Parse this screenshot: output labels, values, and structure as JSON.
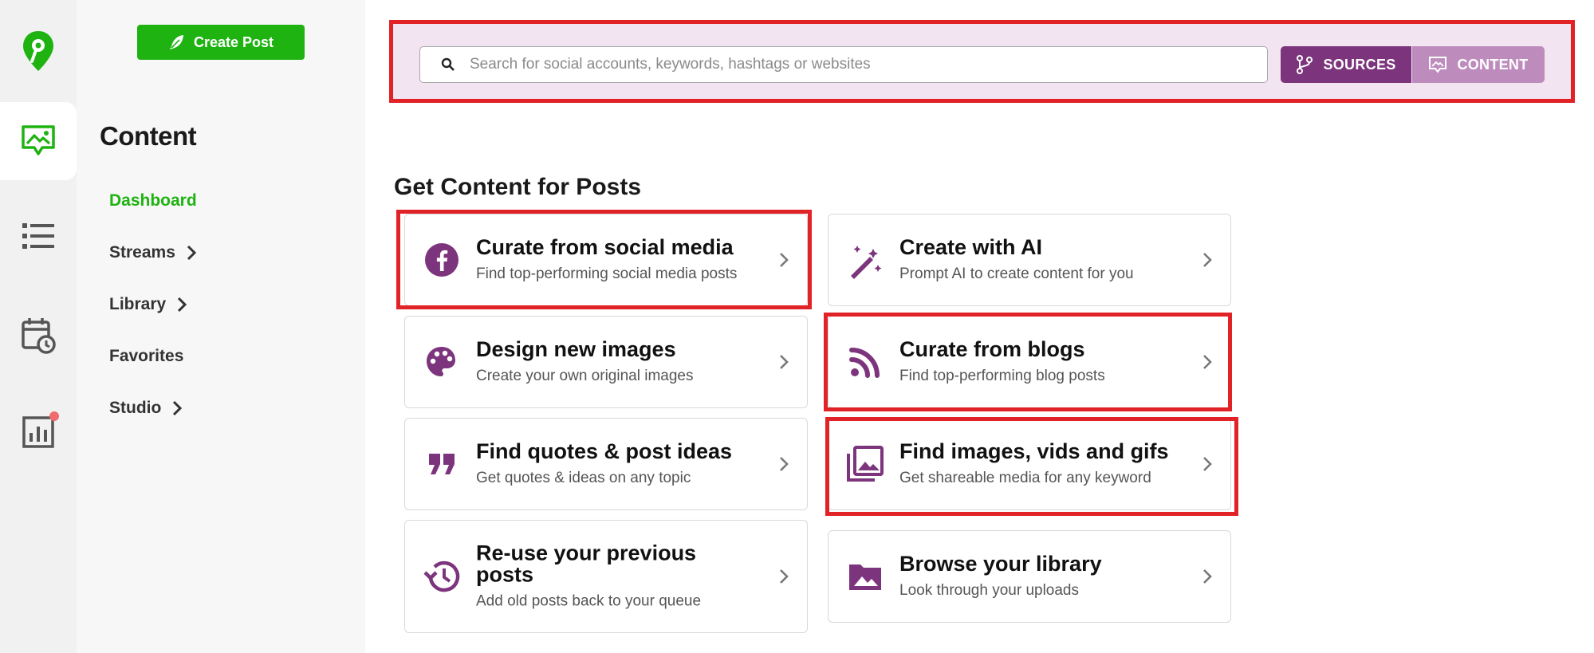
{
  "app": {
    "rail": [
      {
        "icon": "logo-pin-icon"
      },
      {
        "icon": "content-image-icon",
        "active": true
      },
      {
        "icon": "list-icon"
      },
      {
        "icon": "calendar-clock-icon"
      },
      {
        "icon": "bar-chart-icon",
        "notification": true
      }
    ]
  },
  "sidebar": {
    "create_post_label": "Create Post",
    "heading": "Content",
    "items": [
      {
        "label": "Dashboard",
        "active": true,
        "has_chevron": false
      },
      {
        "label": "Streams",
        "has_chevron": true
      },
      {
        "label": "Library",
        "has_chevron": true
      },
      {
        "label": "Favorites",
        "has_chevron": false
      },
      {
        "label": "Studio",
        "has_chevron": true
      }
    ]
  },
  "search": {
    "placeholder": "Search for social accounts, keywords, hashtags or websites",
    "value": "",
    "sources_label": "SOURCES",
    "content_label": "CONTENT"
  },
  "main": {
    "section_title": "Get Content for Posts",
    "cards": [
      {
        "title": "Curate from social media",
        "subtitle": "Find top-performing social media posts",
        "icon": "facebook-icon",
        "highlighted": true
      },
      {
        "title": "Create with AI",
        "subtitle": "Prompt AI to create content for you",
        "icon": "magic-wand-icon",
        "highlighted": false
      },
      {
        "title": "Design new images",
        "subtitle": "Create your own original images",
        "icon": "palette-icon",
        "highlighted": false
      },
      {
        "title": "Curate from blogs",
        "subtitle": "Find top-performing blog posts",
        "icon": "rss-icon",
        "highlighted": true
      },
      {
        "title": "Find quotes & post ideas",
        "subtitle": "Get quotes & ideas on any topic",
        "icon": "quote-icon",
        "highlighted": false
      },
      {
        "title": "Find images, vids and gifs",
        "subtitle": "Get shareable media for any keyword",
        "icon": "image-library-icon",
        "highlighted": true
      },
      {
        "title": "Re-use your previous posts",
        "subtitle": "Add old posts back to your queue",
        "icon": "history-icon",
        "highlighted": false
      },
      {
        "title": "Browse your library",
        "subtitle": "Look through your uploads",
        "icon": "folder-image-icon",
        "highlighted": false
      }
    ]
  },
  "colors": {
    "brand_green": "#1fb312",
    "accent_purple": "#7c357d",
    "accent_purple_light": "#bd8cbd",
    "search_band_bg": "#f3e4f2",
    "highlight_red": "#e12227"
  }
}
